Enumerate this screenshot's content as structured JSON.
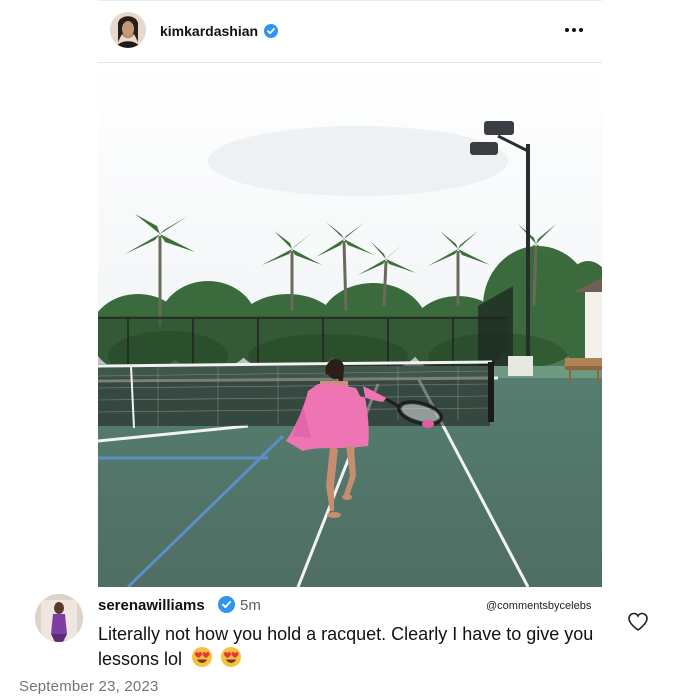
{
  "post": {
    "username": "kimkardashian",
    "verified": true,
    "avatar_icon": "profile-avatar-icon",
    "more_icon": "more-options-icon",
    "photo_icon": "tennis-court-photo"
  },
  "comment": {
    "username": "serenawilliams",
    "verified": true,
    "time": "5m",
    "text": "Literally not how you hold a racquet. Clearly I have to give you lessons lol",
    "emojis": [
      "heart-eyes-emoji",
      "heart-eyes-emoji"
    ],
    "like_icon": "heart-outline-icon"
  },
  "watermark": "@commentsbycelebs",
  "date": "September 23, 2023",
  "colors": {
    "verified_blue": "#2d95f0",
    "court_green": "#4b7a68",
    "court_blue_line": "#5c8ec7",
    "robe_pink": "#ef74b4"
  }
}
